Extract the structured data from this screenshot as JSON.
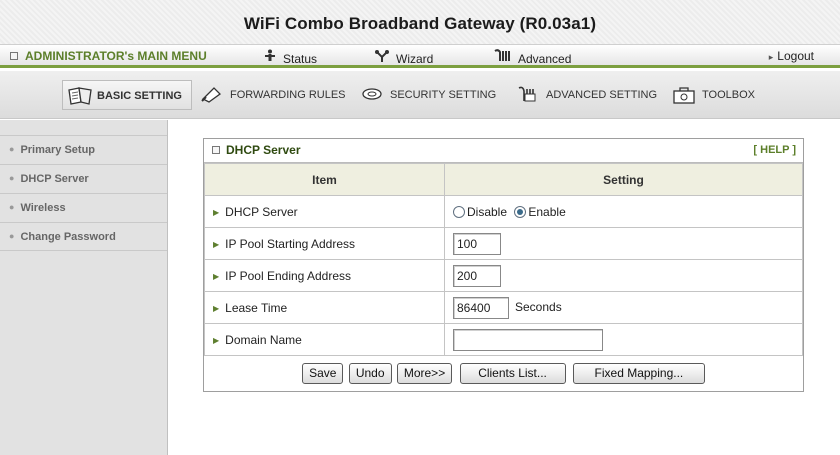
{
  "title": "WiFi Combo Broadband Gateway (R0.03a1)",
  "main_menu": {
    "admin": "ADMINISTRATOR's MAIN MENU",
    "status": "Status",
    "wizard": "Wizard",
    "advanced": "Advanced",
    "logout": "Logout"
  },
  "tabs": [
    {
      "label": "BASIC SETTING",
      "icon": "basic-setting-icon",
      "selected": true
    },
    {
      "label": "FORWARDING RULES",
      "icon": "forwarding-rules-icon"
    },
    {
      "label": "SECURITY SETTING",
      "icon": "security-setting-icon"
    },
    {
      "label": "ADVANCED SETTING",
      "icon": "advanced-setting-icon"
    },
    {
      "label": "TOOLBOX",
      "icon": "toolbox-icon"
    }
  ],
  "sidebar": {
    "items": [
      {
        "label": "Primary Setup"
      },
      {
        "label": "DHCP Server"
      },
      {
        "label": "Wireless"
      },
      {
        "label": "Change Password"
      }
    ]
  },
  "panel": {
    "title": "DHCP Server",
    "help": "[ HELP ]",
    "col_item": "Item",
    "col_setting": "Setting",
    "rows": {
      "dhcp_server": {
        "label": "DHCP Server",
        "opt_disable": "Disable",
        "opt_enable": "Enable",
        "selected": "Enable"
      },
      "pool_start": {
        "label": "IP Pool Starting Address",
        "value": "100"
      },
      "pool_end": {
        "label": "IP Pool Ending Address",
        "value": "200"
      },
      "lease": {
        "label": "Lease Time",
        "value": "86400",
        "unit": "Seconds"
      },
      "domain": {
        "label": "Domain Name",
        "value": ""
      }
    },
    "buttons": {
      "save": "Save",
      "undo": "Undo",
      "more": "More>>",
      "clients": "Clients List...",
      "fixed": "Fixed Mapping..."
    }
  },
  "colors": {
    "accent_green": "#7c9f3f",
    "menu_text_green": "#5c7f2a",
    "sidebar_bg": "#e2e2e2",
    "header_row_bg": "#efefe0"
  }
}
